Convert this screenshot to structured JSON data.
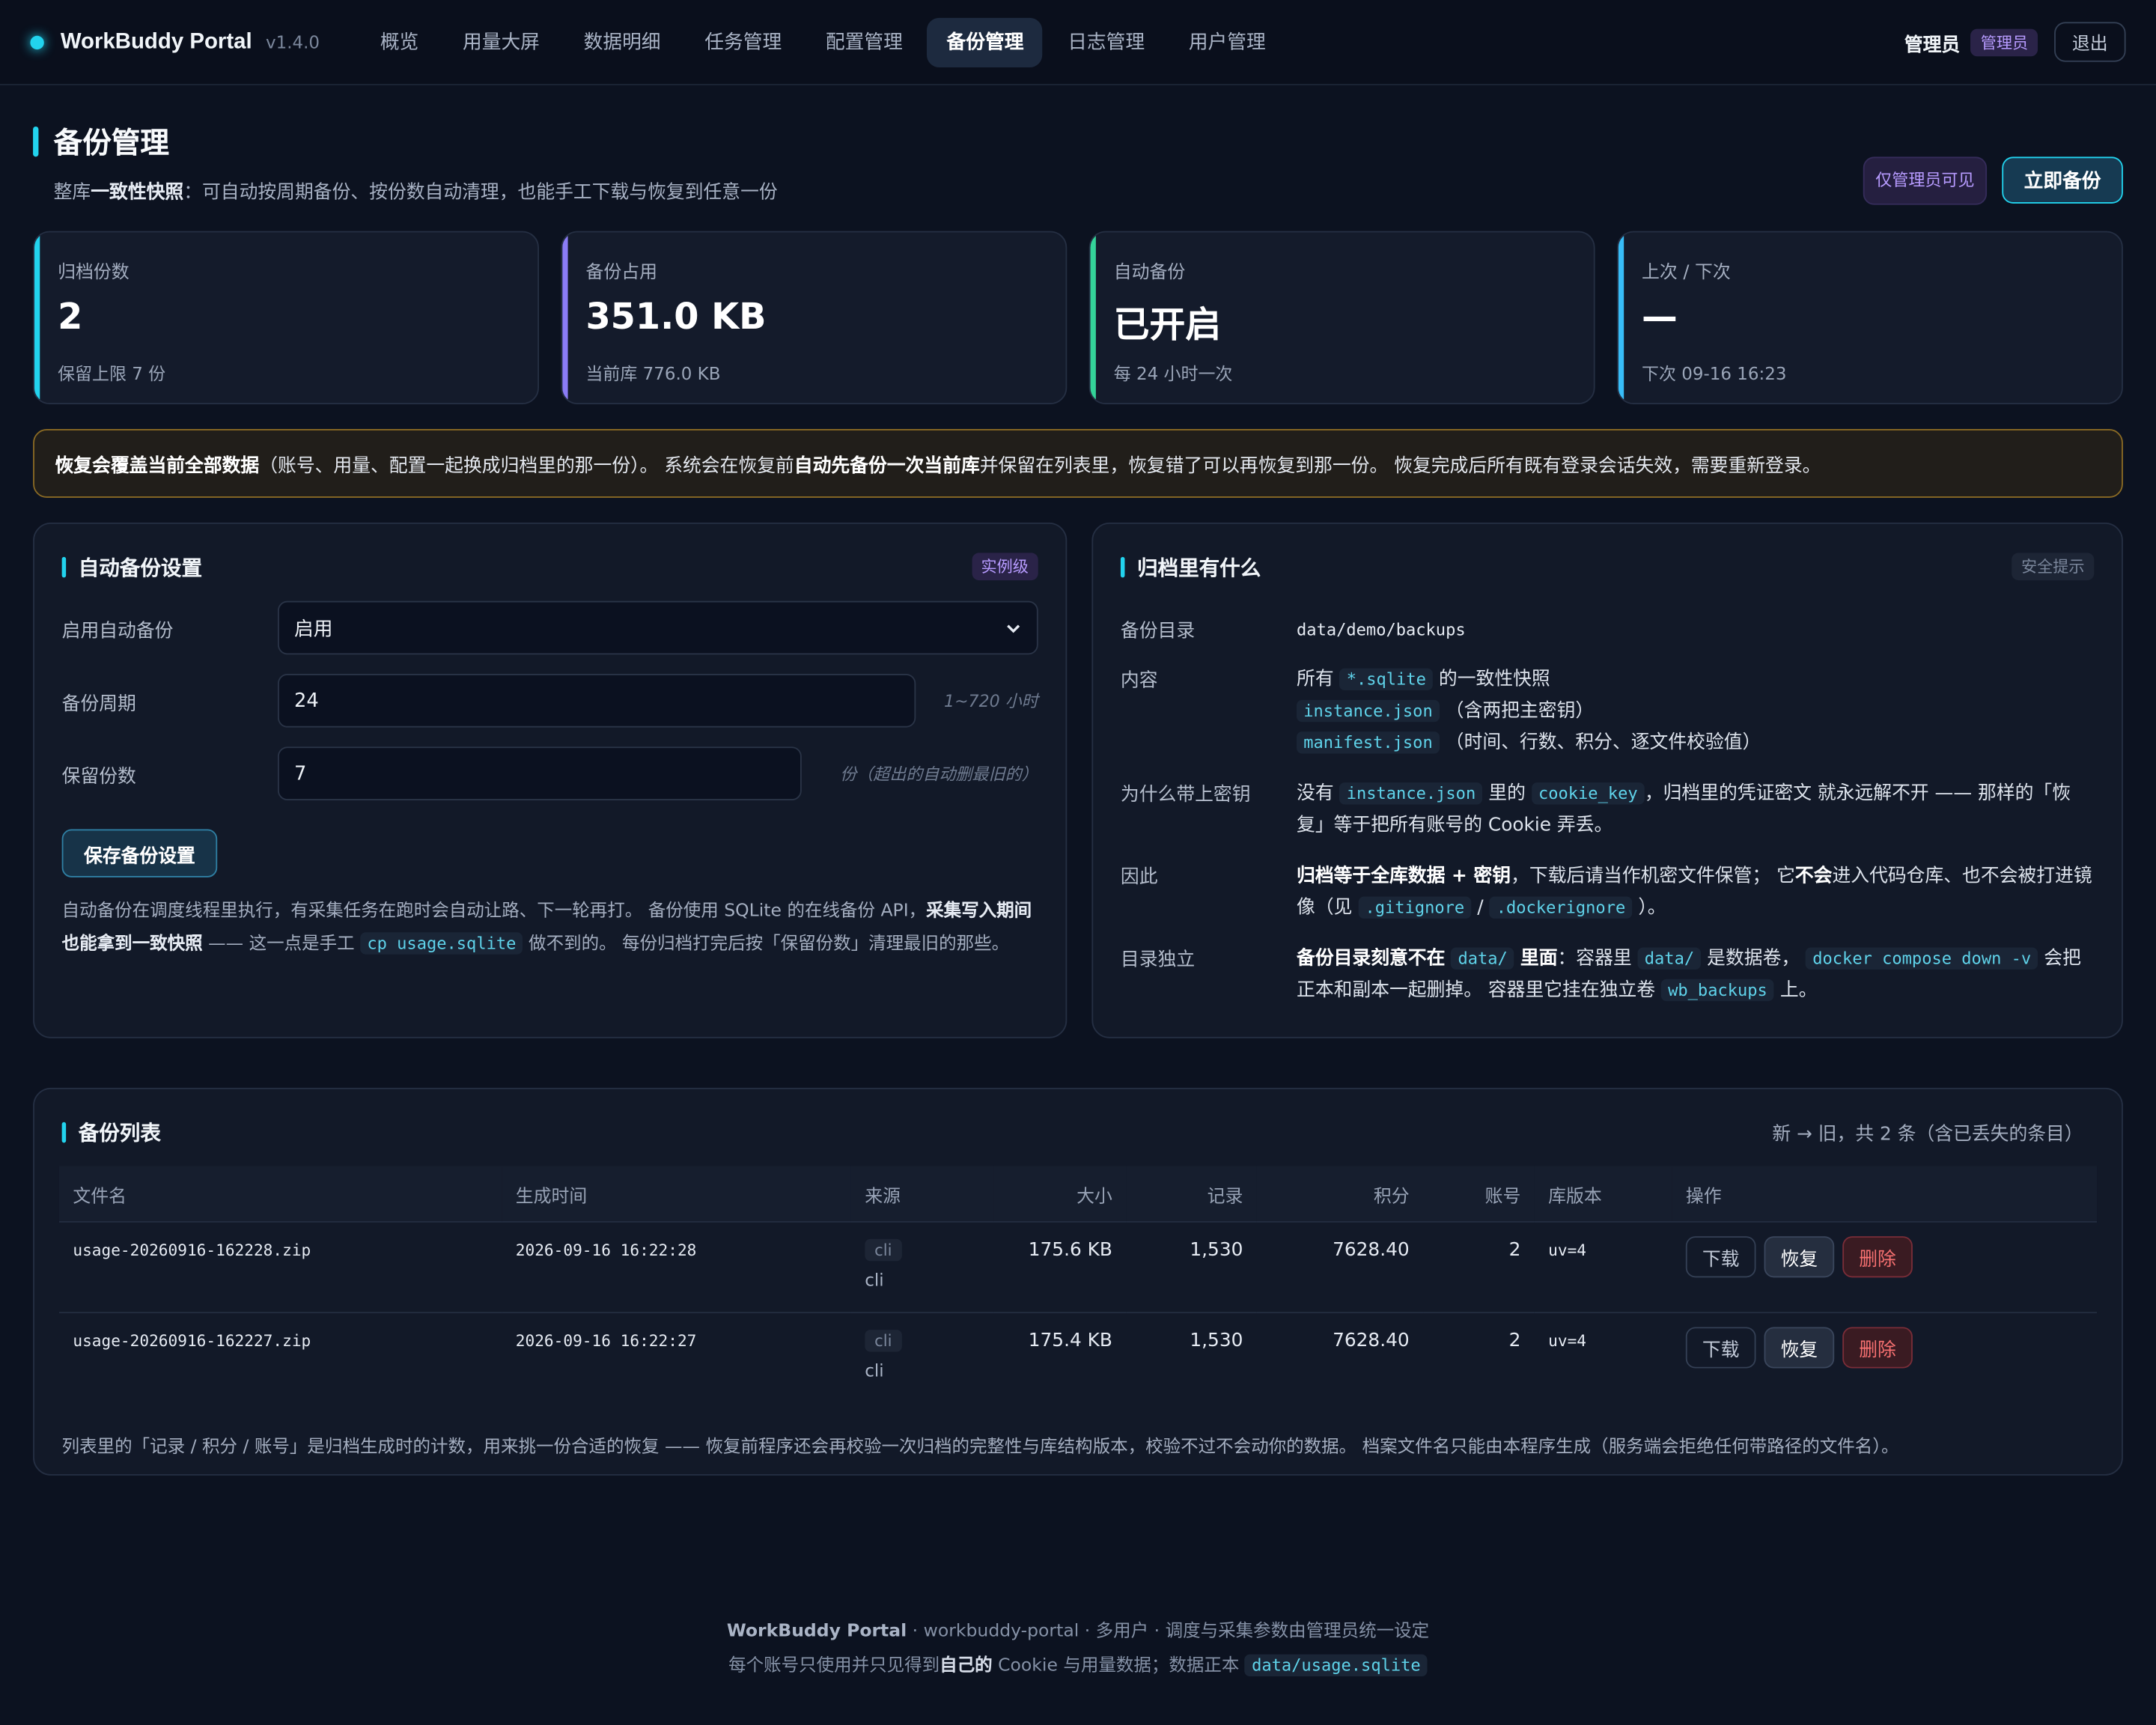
{
  "app": {
    "name": "WorkBuddy Portal",
    "version": "v1.4.0"
  },
  "nav": [
    "概览",
    "用量大屏",
    "数据明细",
    "任务管理",
    "配置管理",
    "备份管理",
    "日志管理",
    "用户管理"
  ],
  "user": {
    "name": "管理员",
    "role_badge": "管理员",
    "logout": "退出"
  },
  "page": {
    "title": "备份管理",
    "subtitle_pre": "整库",
    "subtitle_bold": "一致性快照",
    "subtitle_post": "：可自动按周期备份、按份数自动清理，也能手工下载与恢复到任意一份",
    "admin_only": "仅管理员可见",
    "backup_now": "立即备份"
  },
  "stats": [
    {
      "label": "归档份数",
      "value": "2",
      "note": "保留上限 7 份"
    },
    {
      "label": "备份占用",
      "value": "351.0 KB",
      "note": "当前库 776.0 KB"
    },
    {
      "label": "自动备份",
      "value": "已开启",
      "note": "每 24 小时一次"
    },
    {
      "label": "上次 / 下次",
      "value": "—",
      "note": "下次 09-16 16:23"
    }
  ],
  "warning": {
    "b1": "恢复会覆盖当前全部数据",
    "t1": "（账号、用量、配置一起换成归档里的那一份）。 系统会在恢复前",
    "b2": "自动先备份一次当前库",
    "t2": "并保留在列表里，恢复错了可以再恢复到那一份。 恢复完成后所有既有登录会话失效，需要重新登录。"
  },
  "auto": {
    "title": "自动备份设置",
    "tag": "实例级",
    "enable_label": "启用自动备份",
    "enable_value": "启用",
    "period_label": "备份周期",
    "period_value": "24",
    "period_hint": "1~720 小时",
    "keep_label": "保留份数",
    "keep_value": "7",
    "keep_hint": "份（超出的自动删最旧的）",
    "save": "保存备份设置",
    "note_t1": "自动备份在调度线程里执行，有采集任务在跑时会自动让路、下一轮再打。 备份使用 SQLite 的在线备份 API，",
    "note_b1": "采集写入期间也能拿到一致快照",
    "note_t2": " —— 这一点是手工 ",
    "note_code": "cp usage.sqlite",
    "note_t3": " 做不到的。 每份归档打完后按「保留份数」清理最旧的那些。"
  },
  "archive": {
    "title": "归档里有什么",
    "tag": "安全提示",
    "dir_label": "备份目录",
    "dir_value": "data/demo/backups",
    "content_label": "内容",
    "c1_pre": "所有",
    "c1_code": "*.sqlite",
    "c1_post": "的一致性快照",
    "c2_code": "instance.json",
    "c2_post": "（含两把主密钥）",
    "c3_code": "manifest.json",
    "c3_post": "（时间、行数、积分、逐文件校验值）",
    "why_label": "为什么带上密钥",
    "why_t1": "没有",
    "why_code1": "instance.json",
    "why_t2": "里的",
    "why_code2": "cookie_key",
    "why_t3": "，归档里的凭证密文 就永远解不开 —— 那样的「恢复」等于把所有账号的 Cookie 弄丢。",
    "so_label": "因此",
    "so_b1": "归档等于全库数据 + 密钥",
    "so_t1": "，下载后请当作机密文件保管； 它",
    "so_b2": "不会",
    "so_t2": "进入代码仓库、也不会被打进镜像（见",
    "so_code1": ".gitignore",
    "so_t3": "/",
    "so_code2": ".dockerignore",
    "so_t4": "）。",
    "indep_label": "目录独立",
    "indep_b1": "备份目录刻意不在",
    "indep_code1": "data/",
    "indep_b2": "里面",
    "indep_t1": "：容器里",
    "indep_code2": "data/",
    "indep_t2": "是数据卷，",
    "indep_code3": "docker compose down -v",
    "indep_t3": "会把正本和副本一起删掉。 容器里它挂在独立卷",
    "indep_code4": "wb_backups",
    "indep_t4": "上。"
  },
  "list": {
    "title": "备份列表",
    "summary": "新 → 旧，共 2 条（含已丢失的条目）",
    "headers": [
      "文件名",
      "生成时间",
      "来源",
      "大小",
      "记录",
      "积分",
      "账号",
      "库版本",
      "操作"
    ],
    "rows": [
      {
        "file": "usage-20260916-162228.zip",
        "time": "2026-09-16 16:22:28",
        "src_tag": "cli",
        "src": "cli",
        "size": "175.6 KB",
        "records": "1,530",
        "points": "7628.40",
        "accounts": "2",
        "ver": "uv=4"
      },
      {
        "file": "usage-20260916-162227.zip",
        "time": "2026-09-16 16:22:27",
        "src_tag": "cli",
        "src": "cli",
        "size": "175.4 KB",
        "records": "1,530",
        "points": "7628.40",
        "accounts": "2",
        "ver": "uv=4"
      }
    ],
    "actions": {
      "download": "下载",
      "restore": "恢复",
      "delete": "删除"
    },
    "note": "列表里的「记录 / 积分 / 账号」是归档生成时的计数，用来挑一份合适的恢复 —— 恢复前程序还会再校验一次归档的完整性与库结构版本，校验不过不会动你的数据。 档案文件名只能由本程序生成（服务端会拒绝任何带路径的文件名）。"
  },
  "footer": {
    "brand": "WorkBuddy Portal",
    "line1": " · workbuddy-portal · 多用户 · 调度与采集参数由管理员统一设定",
    "l2_t1": "每个账号只使用并只见得到",
    "l2_b": "自己的",
    "l2_t2": " Cookie 与用量数据；数据正本 ",
    "l2_code": "data/usage.sqlite"
  }
}
